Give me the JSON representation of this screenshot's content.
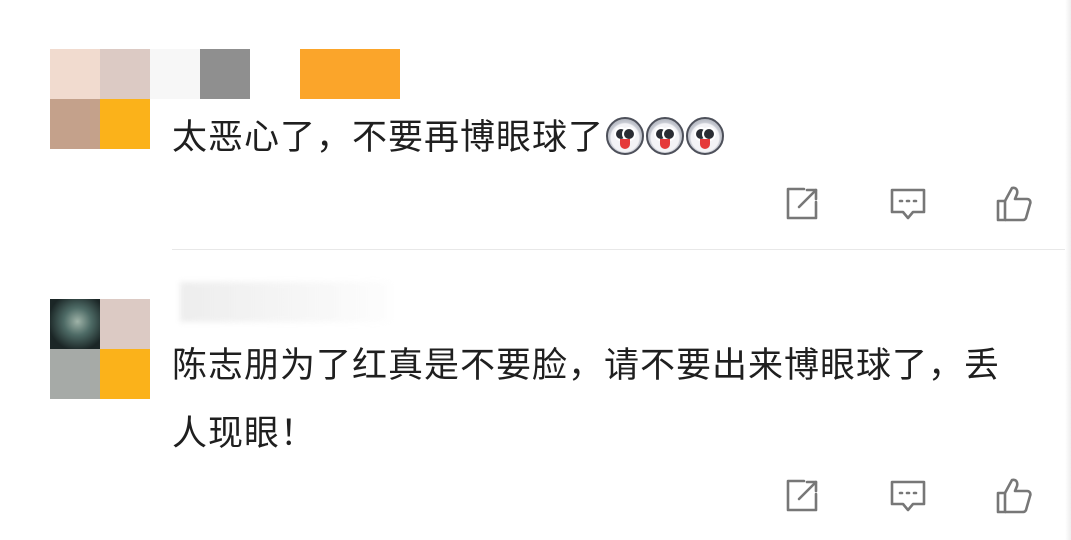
{
  "comments": [
    {
      "text": "太恶心了，不要再博眼球了",
      "emoji_icon": "shocked-face-icon",
      "emoji_count": 3
    },
    {
      "text": "陈志朋为了红真是不要脸，请不要出来博眼球了，丢人现眼！"
    }
  ],
  "actions": {
    "share_icon": "share-icon",
    "comment_icon": "comment-icon",
    "like_icon": "thumbs-up-icon"
  },
  "colors": {
    "text": "#1f1f1f",
    "icon": "#777777",
    "avatar_orange": "#fbb21a",
    "divider": "#e8e8e8"
  }
}
